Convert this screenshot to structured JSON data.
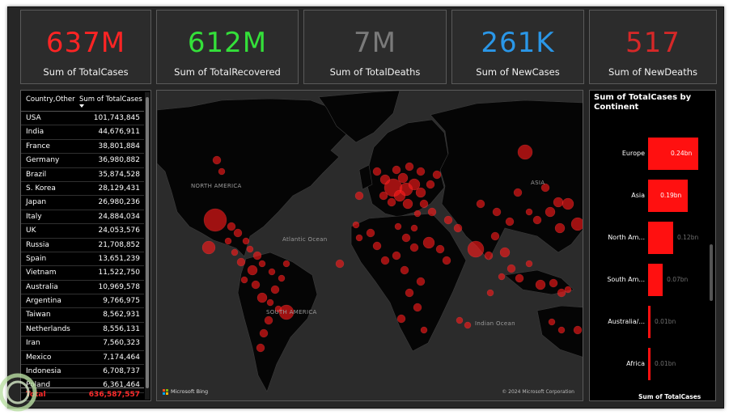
{
  "kpis": [
    {
      "value": "637M",
      "label": "Sum of TotalCases",
      "color": "#ff2424"
    },
    {
      "value": "612M",
      "label": "Sum of TotalRecovered",
      "color": "#34e03a"
    },
    {
      "value": "7M",
      "label": "Sum of TotalDeaths",
      "color": "#7a7a7a"
    },
    {
      "value": "261K",
      "label": "Sum of NewCases",
      "color": "#2a97e8"
    },
    {
      "value": "517",
      "label": "Sum of NewDeaths",
      "color": "#d62828"
    }
  ],
  "table": {
    "col1": "Country,Other",
    "col2": "Sum of TotalCases",
    "rows": [
      {
        "country": "USA",
        "value": "101,743,845"
      },
      {
        "country": "India",
        "value": "44,676,911"
      },
      {
        "country": "France",
        "value": "38,801,884"
      },
      {
        "country": "Germany",
        "value": "36,980,882"
      },
      {
        "country": "Brazil",
        "value": "35,874,528"
      },
      {
        "country": "S. Korea",
        "value": "28,129,431"
      },
      {
        "country": "Japan",
        "value": "26,980,236"
      },
      {
        "country": "Italy",
        "value": "24,884,034"
      },
      {
        "country": "UK",
        "value": "24,053,576"
      },
      {
        "country": "Russia",
        "value": "21,708,852"
      },
      {
        "country": "Spain",
        "value": "13,651,239"
      },
      {
        "country": "Vietnam",
        "value": "11,522,750"
      },
      {
        "country": "Australia",
        "value": "10,969,578"
      },
      {
        "country": "Argentina",
        "value": "9,766,975"
      },
      {
        "country": "Taiwan",
        "value": "8,562,931"
      },
      {
        "country": "Netherlands",
        "value": "8,556,131"
      },
      {
        "country": "Iran",
        "value": "7,560,323"
      },
      {
        "country": "Mexico",
        "value": "7,174,464"
      },
      {
        "country": "Indonesia",
        "value": "6,708,737"
      },
      {
        "country": "Poland",
        "value": "6,361,464"
      }
    ],
    "total_label": "Total",
    "total_value": "636,587,557"
  },
  "map": {
    "labels": {
      "north_america": "NORTH AMERICA",
      "south_america": "SOUTH AMERICA",
      "asia": "ASIA",
      "atlantic": "Atlantic Ocean",
      "indian": "Indian Ocean"
    },
    "provider": "Microsoft Bing",
    "copyright": "© 2024 Microsoft Corporation",
    "bubble_color": "#ff1a1a"
  },
  "chart_data": {
    "type": "bar",
    "orientation": "horizontal",
    "title": "Sum of TotalCases by Continent",
    "xlabel": "Sum of TotalCases",
    "categories": [
      "Europe",
      "Asia",
      "North Am...",
      "South Am...",
      "Australia/...",
      "Africa"
    ],
    "values": [
      0.24,
      0.19,
      0.12,
      0.07,
      0.01,
      0.01
    ],
    "value_labels": [
      "0.24bn",
      "0.19bn",
      "0.12bn",
      "0.07bn",
      "0.01bn",
      "0.01bn"
    ],
    "unit": "bn",
    "xlim": [
      0,
      0.24
    ],
    "bar_color": "#ff1010"
  }
}
